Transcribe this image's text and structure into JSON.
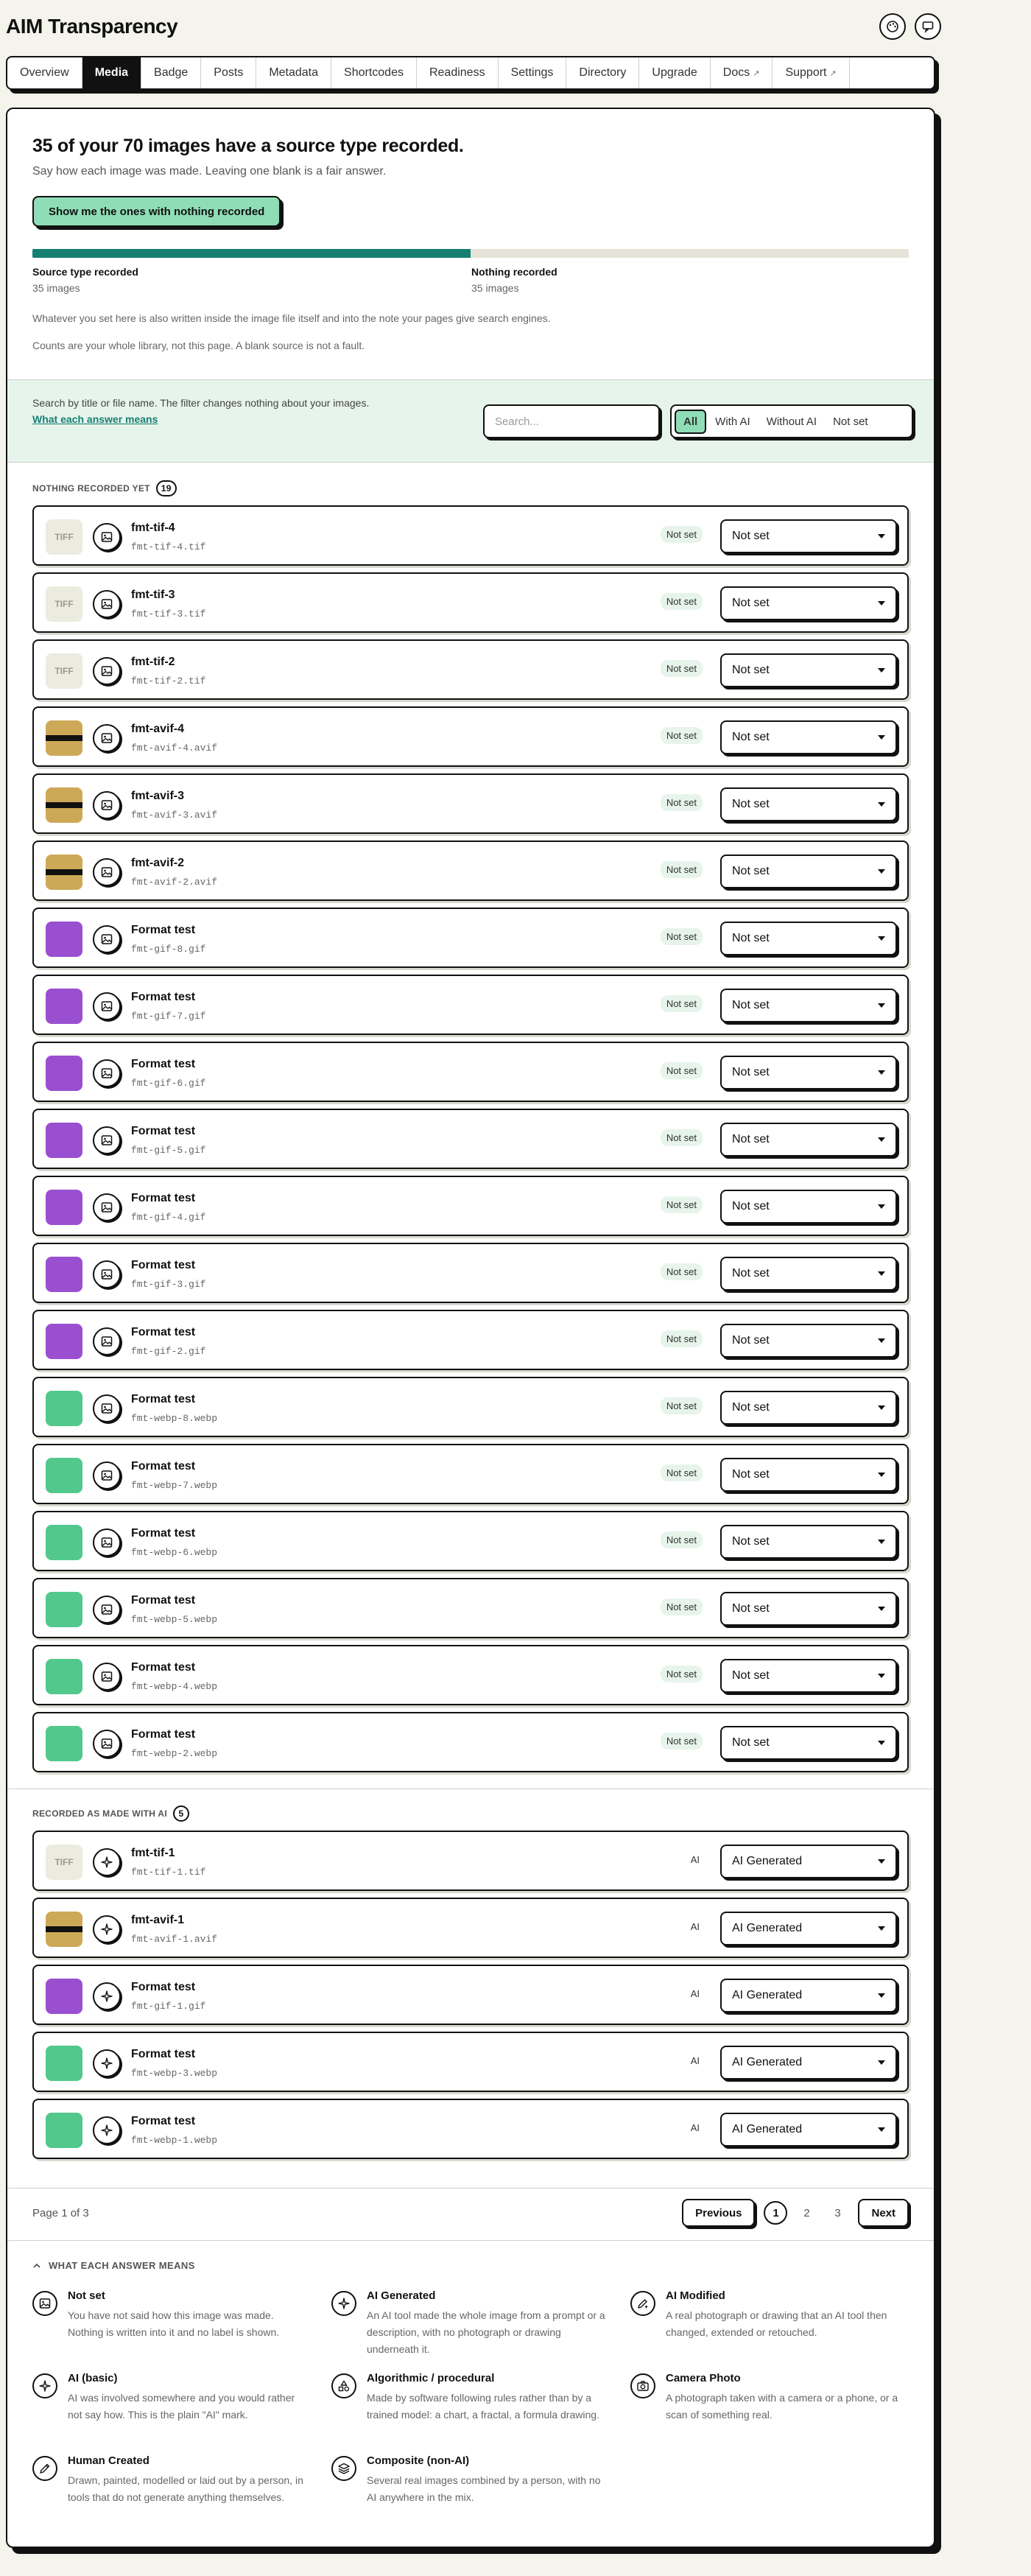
{
  "app": {
    "title": "AIM Transparency"
  },
  "header_icons": [
    {
      "name": "palette-icon",
      "glyph": "◐"
    },
    {
      "name": "chat-icon",
      "glyph": "▭"
    }
  ],
  "tabs": [
    {
      "label": "Overview",
      "active": false,
      "external": false
    },
    {
      "label": "Media",
      "active": true,
      "external": false
    },
    {
      "label": "Badge",
      "active": false,
      "external": false
    },
    {
      "label": "Posts",
      "active": false,
      "external": false
    },
    {
      "label": "Metadata",
      "active": false,
      "external": false
    },
    {
      "label": "Shortcodes",
      "active": false,
      "external": false
    },
    {
      "label": "Readiness",
      "active": false,
      "external": false
    },
    {
      "label": "Settings",
      "active": false,
      "external": false
    },
    {
      "label": "Directory",
      "active": false,
      "external": false
    },
    {
      "label": "Upgrade",
      "active": false,
      "external": false
    },
    {
      "label": "Docs",
      "active": false,
      "external": true
    },
    {
      "label": "Support",
      "active": false,
      "external": true
    }
  ],
  "summary": {
    "title": "35 of your 70 images have a source type recorded.",
    "subtitle": "Say how each image was made. Leaving one blank is a fair answer.",
    "cta_label": "Show me the ones with nothing recorded",
    "progress_fraction": 0.5,
    "recorded_label": "Source type recorded",
    "recorded_value": "35 images",
    "missing_label": "Nothing recorded",
    "missing_value": "35 images",
    "note1": "Whatever you set here is also written inside the image file itself and into the note your pages give search engines.",
    "note2": "Counts are your whole library, not this page. A blank source is not a fault.",
    "colors": {
      "fill": "#157f73",
      "track": "#e6e4d8",
      "accent": "#8fddb6"
    }
  },
  "filter": {
    "help_text": "Search by title or file name. The filter changes nothing about your images.",
    "help_link": "What each answer means",
    "search_placeholder": "Search...",
    "options": [
      "All",
      "With AI",
      "Without AI",
      "Not set"
    ],
    "active": "All"
  },
  "unset_section": {
    "heading": "NOTHING RECORDED YET",
    "count": "19",
    "rows": [
      {
        "title": "fmt-tif-4",
        "file": "fmt-tif-4.tif",
        "thumb": "tif",
        "badge": "Not set",
        "value": "Not set"
      },
      {
        "title": "fmt-tif-3",
        "file": "fmt-tif-3.tif",
        "thumb": "tif",
        "badge": "Not set",
        "value": "Not set"
      },
      {
        "title": "fmt-tif-2",
        "file": "fmt-tif-2.tif",
        "thumb": "tif",
        "badge": "Not set",
        "value": "Not set"
      },
      {
        "title": "fmt-avif-4",
        "file": "fmt-avif-4.avif",
        "thumb": "avif",
        "badge": "Not set",
        "value": "Not set"
      },
      {
        "title": "fmt-avif-3",
        "file": "fmt-avif-3.avif",
        "thumb": "avif",
        "badge": "Not set",
        "value": "Not set"
      },
      {
        "title": "fmt-avif-2",
        "file": "fmt-avif-2.avif",
        "thumb": "avif",
        "badge": "Not set",
        "value": "Not set"
      },
      {
        "title": "Format test",
        "file": "fmt-gif-8.gif",
        "thumb": "gif",
        "badge": "Not set",
        "value": "Not set"
      },
      {
        "title": "Format test",
        "file": "fmt-gif-7.gif",
        "thumb": "gif",
        "badge": "Not set",
        "value": "Not set"
      },
      {
        "title": "Format test",
        "file": "fmt-gif-6.gif",
        "thumb": "gif",
        "badge": "Not set",
        "value": "Not set"
      },
      {
        "title": "Format test",
        "file": "fmt-gif-5.gif",
        "thumb": "gif",
        "badge": "Not set",
        "value": "Not set"
      },
      {
        "title": "Format test",
        "file": "fmt-gif-4.gif",
        "thumb": "gif",
        "badge": "Not set",
        "value": "Not set"
      },
      {
        "title": "Format test",
        "file": "fmt-gif-3.gif",
        "thumb": "gif",
        "badge": "Not set",
        "value": "Not set"
      },
      {
        "title": "Format test",
        "file": "fmt-gif-2.gif",
        "thumb": "gif",
        "badge": "Not set",
        "value": "Not set"
      },
      {
        "title": "Format test",
        "file": "fmt-webp-8.webp",
        "thumb": "webp",
        "badge": "Not set",
        "value": "Not set"
      },
      {
        "title": "Format test",
        "file": "fmt-webp-7.webp",
        "thumb": "webp",
        "badge": "Not set",
        "value": "Not set"
      },
      {
        "title": "Format test",
        "file": "fmt-webp-6.webp",
        "thumb": "webp",
        "badge": "Not set",
        "value": "Not set"
      },
      {
        "title": "Format test",
        "file": "fmt-webp-5.webp",
        "thumb": "webp",
        "badge": "Not set",
        "value": "Not set"
      },
      {
        "title": "Format test",
        "file": "fmt-webp-4.webp",
        "thumb": "webp",
        "badge": "Not set",
        "value": "Not set"
      },
      {
        "title": "Format test",
        "file": "fmt-webp-2.webp",
        "thumb": "webp",
        "badge": "Not set",
        "value": "Not set"
      }
    ]
  },
  "ai_section": {
    "heading": "RECORDED AS MADE WITH AI",
    "count": "5",
    "rows": [
      {
        "title": "fmt-tif-1",
        "file": "fmt-tif-1.tif",
        "thumb": "tif",
        "badge": "AI",
        "value": "AI Generated"
      },
      {
        "title": "fmt-avif-1",
        "file": "fmt-avif-1.avif",
        "thumb": "avif",
        "badge": "AI",
        "value": "AI Generated"
      },
      {
        "title": "Format test",
        "file": "fmt-gif-1.gif",
        "thumb": "gif",
        "badge": "AI",
        "value": "AI Generated"
      },
      {
        "title": "Format test",
        "file": "fmt-webp-3.webp",
        "thumb": "webp",
        "badge": "AI",
        "value": "AI Generated"
      },
      {
        "title": "Format test",
        "file": "fmt-webp-1.webp",
        "thumb": "webp",
        "badge": "AI",
        "value": "AI Generated"
      }
    ]
  },
  "thumb_text": {
    "tif": "TIFF"
  },
  "pager": {
    "text": "Page 1 of 3",
    "prev": "Previous",
    "next": "Next",
    "pages": [
      "1",
      "2",
      "3"
    ],
    "current": "1"
  },
  "legend": {
    "heading": "WHAT EACH ANSWER MEANS",
    "items": [
      {
        "title": "Not set",
        "desc": "You have not said how this image was made. Nothing is written into it and no label is shown.",
        "icon": "image-icon"
      },
      {
        "title": "AI Generated",
        "desc": "An AI tool made the whole image from a prompt or a description, with no photograph or drawing underneath it.",
        "icon": "sparkle-icon"
      },
      {
        "title": "AI Modified",
        "desc": "A real photograph or drawing that an AI tool then changed, extended or retouched.",
        "icon": "edit-sparkle-icon"
      },
      {
        "title": "AI (basic)",
        "desc": "AI was involved somewhere and you would rather not say how. This is the plain \"AI\" mark.",
        "icon": "sparkle-icon"
      },
      {
        "title": "Algorithmic / procedural",
        "desc": "Made by software following rules rather than by a trained model: a chart, a fractal, a formula drawing.",
        "icon": "shapes-icon"
      },
      {
        "title": "Camera Photo",
        "desc": "A photograph taken with a camera or a phone, or a scan of something real.",
        "icon": "camera-icon"
      },
      {
        "title": "Human Created",
        "desc": "Drawn, painted, modelled or laid out by a person, in tools that do not generate anything themselves.",
        "icon": "pen-icon"
      },
      {
        "title": "Composite (non-AI)",
        "desc": "Several real images combined by a person, with no AI anywhere in the mix.",
        "icon": "layers-icon"
      }
    ]
  }
}
